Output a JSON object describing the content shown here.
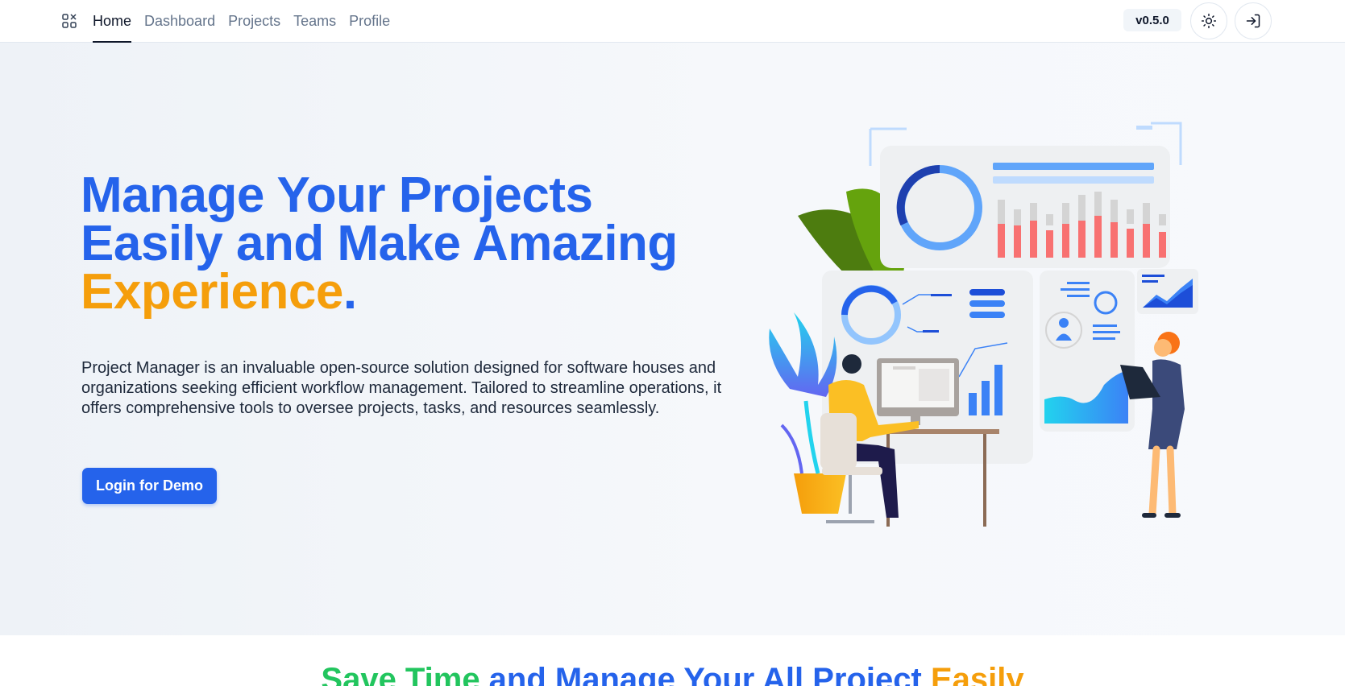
{
  "nav": {
    "links": [
      "Home",
      "Dashboard",
      "Projects",
      "Teams",
      "Profile"
    ],
    "active": "Home",
    "version": "v0.5.0"
  },
  "hero": {
    "title_line1": "Manage Your Projects",
    "title_line2": "Easily and Make Amazing",
    "title_accent": "Experience",
    "title_dot": ".",
    "description": "Project Manager is an invaluable open-source solution designed for software houses and organizations seeking efficient workflow management. Tailored to streamline operations, it offers comprehensive tools to oversee projects, tasks, and resources seamlessly.",
    "cta_label": "Login for Demo"
  },
  "section": {
    "title_part1": "Save Time",
    "title_part2": " and Manage Your All Project ",
    "title_part3": "Easily"
  },
  "colors": {
    "primary": "#2563eb",
    "accent": "#f59e0b",
    "green": "#22c55e"
  },
  "icons": [
    "logo-icon",
    "sun-icon",
    "login-icon"
  ]
}
